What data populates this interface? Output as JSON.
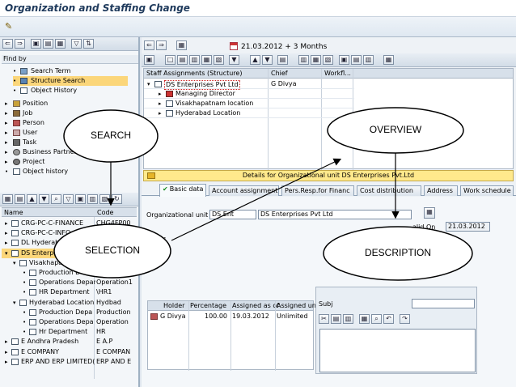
{
  "window": {
    "title": "Organization and Staffing Change"
  },
  "left_panel": {
    "find_by_label": "Find by",
    "find_items": [
      {
        "label": "Search Term",
        "selected": false
      },
      {
        "label": "Structure Search",
        "selected": true
      },
      {
        "label": "Object History",
        "selected": false
      }
    ],
    "object_types": [
      "Position",
      "Job",
      "Person",
      "User",
      "Task",
      "Business Partner",
      "Project",
      "Object history"
    ],
    "columns": {
      "name": "Name",
      "code": "Code"
    },
    "rows": [
      {
        "name": "CRG-PC-C-FINANCE",
        "code": "CHG4FP00"
      },
      {
        "name": "CRG-PC-C-INFO.",
        "code": ""
      },
      {
        "name": "DL Hyderab",
        "code": ""
      },
      {
        "name": "DS Enterprise",
        "code": ""
      },
      {
        "name": "Visakhapa",
        "code": ""
      },
      {
        "name": "Production D",
        "code": ""
      },
      {
        "name": "Operations Depar",
        "code": "Operation1"
      },
      {
        "name": "HR Department",
        "code": "\\HR1"
      },
      {
        "name": "Hyderabad Location",
        "code": "Hydbad"
      },
      {
        "name": "Production Depa",
        "code": "Production"
      },
      {
        "name": "Operations Depa",
        "code": "Operation"
      },
      {
        "name": "Hr Department",
        "code": "HR"
      },
      {
        "name": "E Andhra Pradesh",
        "code": "E A.P"
      },
      {
        "name": "E COMPANY",
        "code": "E COMPAN"
      },
      {
        "name": "ERP AND ERP LIMITED(",
        "code": "ERP AND E"
      }
    ]
  },
  "top": {
    "date_text": "21.03.2012  + 3 Months"
  },
  "structure_grid": {
    "headers": [
      "Staff Assignments (Structure)",
      "Chief",
      "Workfl..."
    ],
    "rows": [
      {
        "label": "DS Enterprises Pvt Ltd",
        "chief": "G Divya"
      },
      {
        "label": "Managing Director",
        "chief": ""
      },
      {
        "label": "Visakhapatnam location",
        "chief": ""
      },
      {
        "label": "Hyderabad Location",
        "chief": ""
      }
    ]
  },
  "details": {
    "title": "Details for Organizational unit DS Enterprises Pvt.Ltd"
  },
  "tabs": [
    {
      "label": "Basic data",
      "active": true
    },
    {
      "label": "Account assignment",
      "active": false
    },
    {
      "label": "Pers.Resp.for Financ",
      "active": false
    },
    {
      "label": "Cost distribution",
      "active": false
    },
    {
      "label": "Address",
      "active": false
    },
    {
      "label": "Work schedule",
      "active": false
    }
  ],
  "form": {
    "org_unit_label": "Organizational unit",
    "org_unit_code": "DS Ent",
    "org_unit_name": "DS Enterprises Pvt Ltd",
    "valid_on_label": "alid On",
    "valid_on_value": "21.03.2012",
    "staff_label": "ff",
    "holder_headers": [
      "Holder",
      "Percentage",
      "Assigned as of",
      "Assigned un..."
    ],
    "holder_row": {
      "holder": "G Divya",
      "percentage": "100.00",
      "assigned_from": "19.03.2012",
      "assigned_until": "Unlimited"
    },
    "subject_label": "Subj"
  },
  "annotations": {
    "search": "SEARCH",
    "overview": "OVERVIEW",
    "selection": "SELECTION",
    "description": "DESCRIPTION"
  },
  "colors": {
    "selected_row": "#fbd67a",
    "details_bar": "#ffe98c",
    "title_text": "#1f3a5c"
  }
}
